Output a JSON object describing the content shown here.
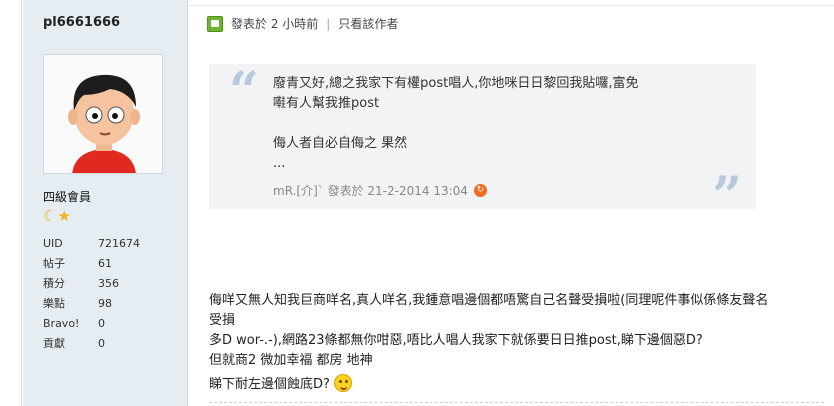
{
  "user": {
    "name": "pl6661666",
    "rank": "四級會員",
    "rank_icons": "☾★",
    "stats": [
      {
        "label": "UID",
        "value": "721674"
      },
      {
        "label": "帖子",
        "value": "61"
      },
      {
        "label": "積分",
        "value": "356"
      },
      {
        "label": "樂點",
        "value": "98"
      },
      {
        "label": "Bravo!",
        "value": "0"
      },
      {
        "label": "貢獻",
        "value": "0"
      }
    ]
  },
  "post": {
    "posted": "發表於 2 小時前",
    "separator": "|",
    "author_only": "只看該作者"
  },
  "quote": {
    "open_mark": "“",
    "close_mark": "”",
    "line1": "廢青又好,總之我家下有權post唱人,你地咪日日黎回我貼囉,富免",
    "line2": "嚡有人幫我推post",
    "line3": "侮人者自必自侮之 果然",
    "line4": "...",
    "meta": "mR.[介]` 發表於 21-2-2014 13:04",
    "jump_icon": "arrow-jump-icon"
  },
  "body": {
    "line1": "侮咩又無人知我巨商咩名,真人咩名,我鍾意唱邊個都唔驚自己名聲受損啦(同理呢件事似係條友聲名受損",
    "line2": "多D wor-.-),網路23條都無你咁惡,唔比人唱人我家下就係要日日推post,睇下邊個惡D?",
    "line3": "但就商2 微加幸福 都房 地神",
    "line4": "睇下耐左邊個蝕底D?",
    "emoticon": "smiley-icon"
  },
  "colors": {
    "sidebar_bg": "#e5edf2",
    "quote_bg": "#f2f3f4",
    "quote_mark": "#b9c9dc",
    "online_green": "#6fb32e",
    "jump_orange": "#f36b21"
  }
}
